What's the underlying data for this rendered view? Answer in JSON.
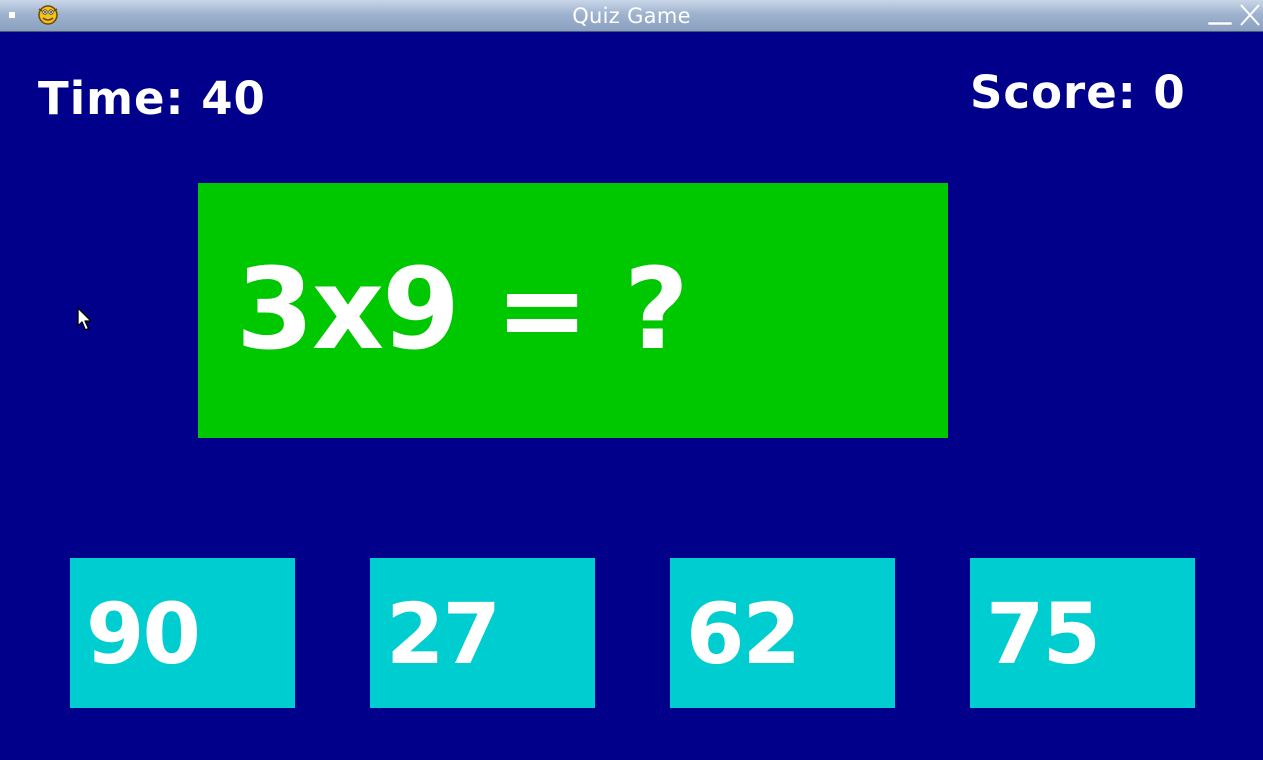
{
  "window": {
    "title": "Quiz Game",
    "icon": "pygame-snake-icon",
    "controls": [
      "minimize-icon",
      "close-icon"
    ]
  },
  "hud": {
    "time_label": "Time: 40",
    "score_label": "Score: 0"
  },
  "question": {
    "text": "3x9 = ?"
  },
  "answers": [
    {
      "label": "90"
    },
    {
      "label": "27"
    },
    {
      "label": "62"
    },
    {
      "label": "75"
    }
  ],
  "colors": {
    "background": "#01008b",
    "question_box": "#00c800",
    "answer_box": "#00cdd0",
    "text": "#ffffff"
  }
}
